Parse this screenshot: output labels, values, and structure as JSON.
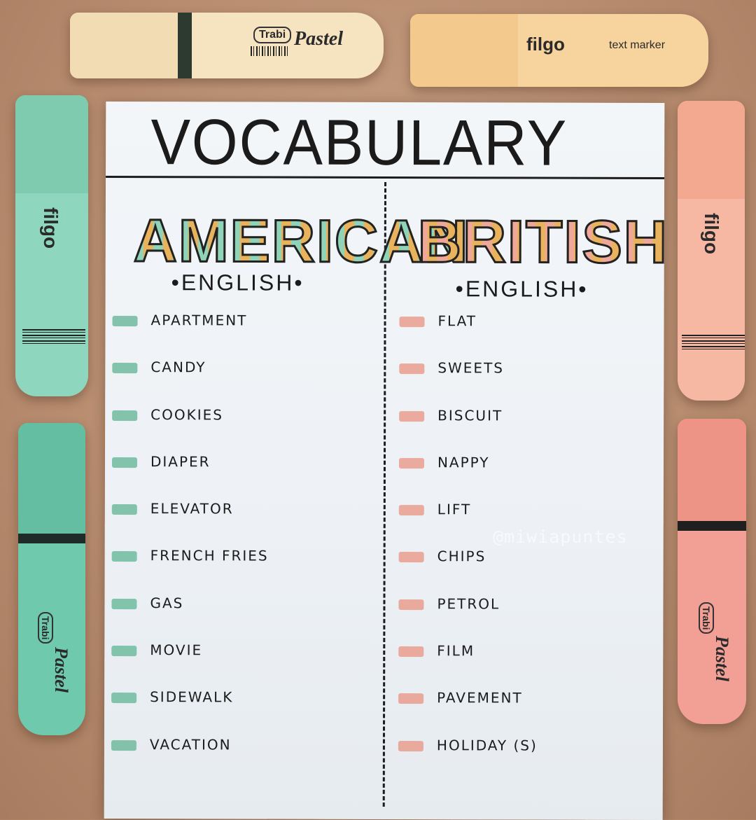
{
  "sheet": {
    "title": "VOCABULARY",
    "columns": [
      {
        "header": "AMERICAN",
        "subheader": "•ENGLISH•",
        "swatch_color": "#77bea3",
        "terms": [
          "APARTMENT",
          "CANDY",
          "COOKIES",
          "DIAPER",
          "ELEVATOR",
          "FRENCH FRIES",
          "GAS",
          "MOVIE",
          "SIDEWALK",
          "VACATION"
        ]
      },
      {
        "header": "BRITISH",
        "subheader": "•ENGLISH•",
        "swatch_color": "#e9a294",
        "terms": [
          "FLAT",
          "SWEETS",
          "BISCUIT",
          "NAPPY",
          "LIFT",
          "CHIPS",
          "PETROL",
          "FILM",
          "PAVEMENT",
          "HOLIDAY (S)"
        ]
      }
    ]
  },
  "watermark": "@miwiapuntes",
  "markers": {
    "top_left": {
      "brand": "Trabi",
      "label": "Pastel",
      "color": "#f6e3c0"
    },
    "top_right": {
      "brand": "filgo",
      "label": "text marker",
      "color": "#f7d39d"
    },
    "left_top": {
      "brand": "filgo",
      "color": "#8fd6be"
    },
    "left_bottom": {
      "brand": "Trabi",
      "label": "Pastel",
      "color": "#6ec9ad"
    },
    "right_top": {
      "brand": "filgo",
      "color": "#f6b8a2"
    },
    "right_bottom": {
      "brand": "Trabi",
      "label": "Pastel",
      "color": "#f2a095"
    }
  }
}
